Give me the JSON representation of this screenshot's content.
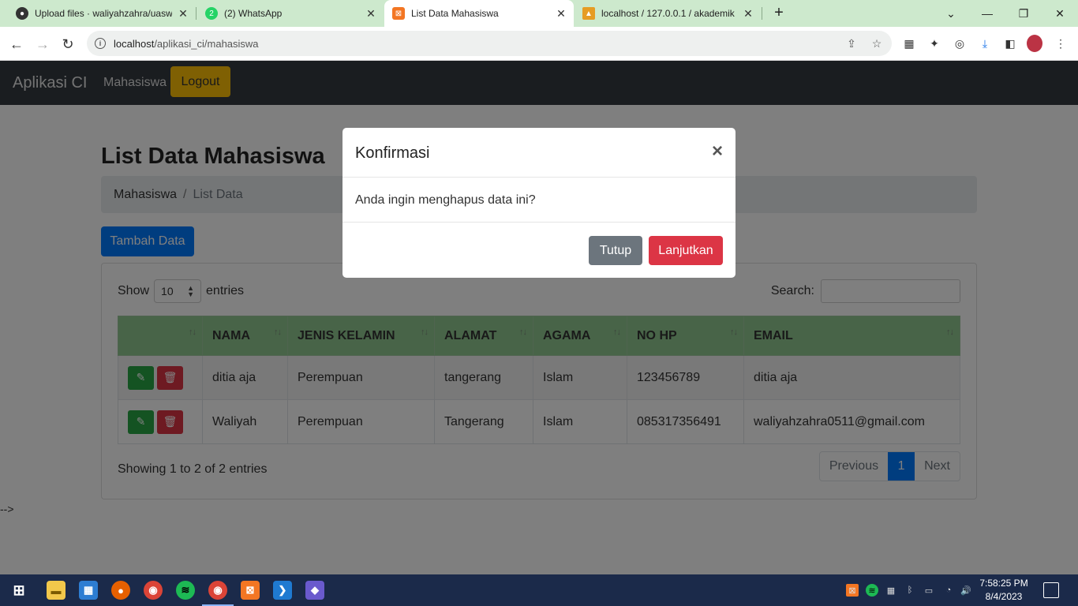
{
  "browser": {
    "tabs": [
      {
        "title": "Upload files · waliyahzahra/uasw",
        "icon": "github-icon"
      },
      {
        "title": "(2) WhatsApp",
        "icon": "whatsapp-icon"
      },
      {
        "title": "List Data Mahasiswa",
        "icon": "xampp-icon"
      },
      {
        "title": "localhost / 127.0.0.1 / akademik |",
        "icon": "phpmyadmin-icon"
      }
    ],
    "url_host": "localhost",
    "url_path": "/aplikasi_ci/mahasiswa"
  },
  "app": {
    "brand": "Aplikasi CI",
    "nav_link": "Mahasiswa",
    "logout_label": "Logout"
  },
  "page": {
    "title": "List Data Mahasiswa",
    "breadcrumb_1": "Mahasiswa",
    "breadcrumb_sep": "/",
    "breadcrumb_2": "List Data",
    "add_button": "Tambah Data",
    "show_label": "Show",
    "show_value": "10",
    "entries_label": "entries",
    "search_label": "Search:",
    "columns": [
      "NAMA",
      "JENIS KELAMIN",
      "ALAMAT",
      "AGAMA",
      "NO HP",
      "EMAIL"
    ],
    "rows": [
      {
        "nama": "ditia aja",
        "jk": "Perempuan",
        "alamat": "tangerang",
        "agama": "Islam",
        "hp": "123456789",
        "email": "ditia aja"
      },
      {
        "nama": "Waliyah",
        "jk": "Perempuan",
        "alamat": "Tangerang",
        "agama": "Islam",
        "hp": "085317356491",
        "email": "waliyahzahra0511@gmail.com"
      }
    ],
    "showing": "Showing 1 to 2 of 2 entries",
    "prev": "Previous",
    "current_page": "1",
    "next": "Next",
    "stray_text": "-->"
  },
  "modal": {
    "title": "Konfirmasi",
    "close_glyph": "×",
    "body": "Anda ingin menghapus data ini?",
    "cancel": "Tutup",
    "confirm": "Lanjutkan"
  },
  "taskbar": {
    "time": "7:58:25 PM",
    "date": "8/4/2023"
  },
  "colors": {
    "navbar": "#343a40",
    "table_header": "#90c890",
    "primary": "#007bff",
    "danger": "#dc3545",
    "warning": "#ffc107"
  }
}
